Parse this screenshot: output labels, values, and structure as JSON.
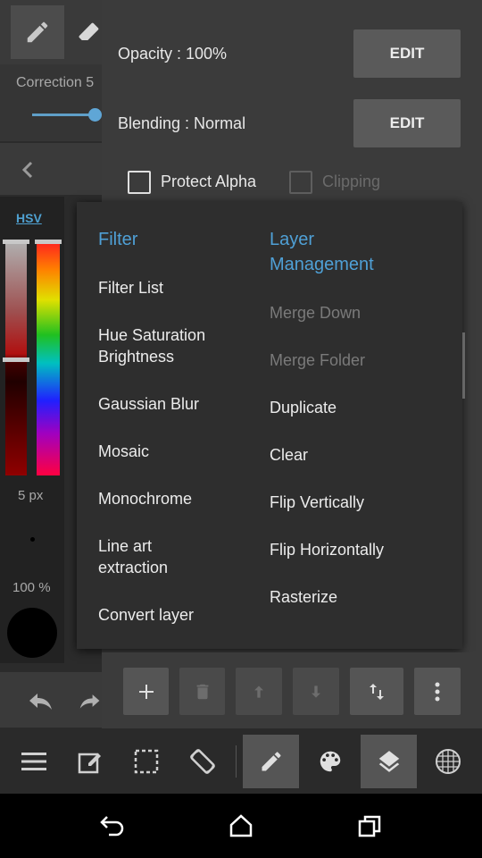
{
  "left_panel": {
    "correction_label": "Correction 5",
    "color_mode_label": "HSV",
    "brush_size": "5 px",
    "brush_opacity": "100 %",
    "current_color": "#000000"
  },
  "layer_props": {
    "opacity_label": "Opacity : 100%",
    "blending_label": "Blending : Normal",
    "edit_label": "EDIT",
    "protect_alpha_label": "Protect Alpha",
    "clipping_label": "Clipping"
  },
  "popup": {
    "filter": {
      "heading": "Filter",
      "items": [
        "Filter List",
        "Hue Saturation Brightness",
        "Gaussian Blur",
        "Mosaic",
        "Monochrome",
        "Line art extraction",
        "Convert layer"
      ]
    },
    "layer_management": {
      "heading": "Layer Management",
      "items": [
        "Merge Down",
        "Merge Folder",
        "Duplicate",
        "Clear",
        "Flip Vertically",
        "Flip Horizontally",
        "Rasterize"
      ],
      "disabled_items": [
        "Merge Down",
        "Merge Folder"
      ]
    }
  },
  "layer_toolbar": {
    "icons": [
      "plus-icon",
      "trash-icon",
      "arrow-up-icon",
      "arrow-down-icon",
      "swap-vertical-icon",
      "more-vertical-icon"
    ]
  },
  "bottom_toolbar": {
    "icons": [
      "menu-icon",
      "edit-document-icon",
      "selection-icon",
      "rotate-screen-icon",
      "pen-icon",
      "palette-icon",
      "layers-icon",
      "grid-icon"
    ],
    "active": [
      "pen-icon",
      "layers-icon"
    ]
  },
  "colors": {
    "accent": "#4fa0d6",
    "panel_bg": "#3b3b3b",
    "popup_bg": "#2e2e2e",
    "button_bg": "#5a5a5a"
  }
}
